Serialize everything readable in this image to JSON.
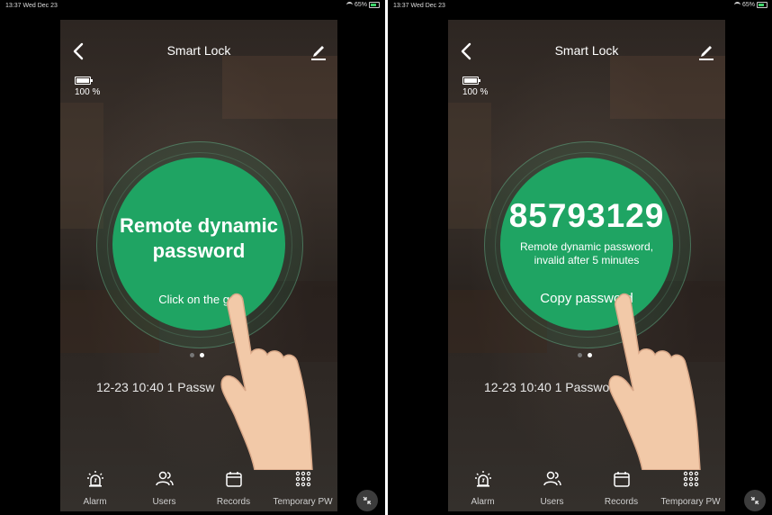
{
  "statusbar": {
    "time": "13:37",
    "date": "Wed Dec 23",
    "battery_left": "65%",
    "battery_right": "65%"
  },
  "app": {
    "title": "Smart Lock",
    "battery_percent": "100 %"
  },
  "left_circle": {
    "title_line1": "Remote dynamic",
    "title_line2": "password",
    "subtitle": "Click on the get"
  },
  "right_circle": {
    "code": "85793129",
    "desc_line1": "Remote dynamic password,",
    "desc_line2": "invalid after 5 minutes",
    "copy_label": "Copy password"
  },
  "record": {
    "left": "12-23 10:40  1 Passw",
    "right": "12-23 10:40  1 Passwo"
  },
  "tabs": [
    {
      "label": "Alarm",
      "icon": "alarm-icon"
    },
    {
      "label": "Users",
      "icon": "users-icon"
    },
    {
      "label": "Records",
      "icon": "calendar-icon"
    },
    {
      "label": "Temporary PW",
      "icon": "keypad-icon"
    }
  ],
  "colors": {
    "accent": "#1fa463",
    "background": "#000000"
  }
}
